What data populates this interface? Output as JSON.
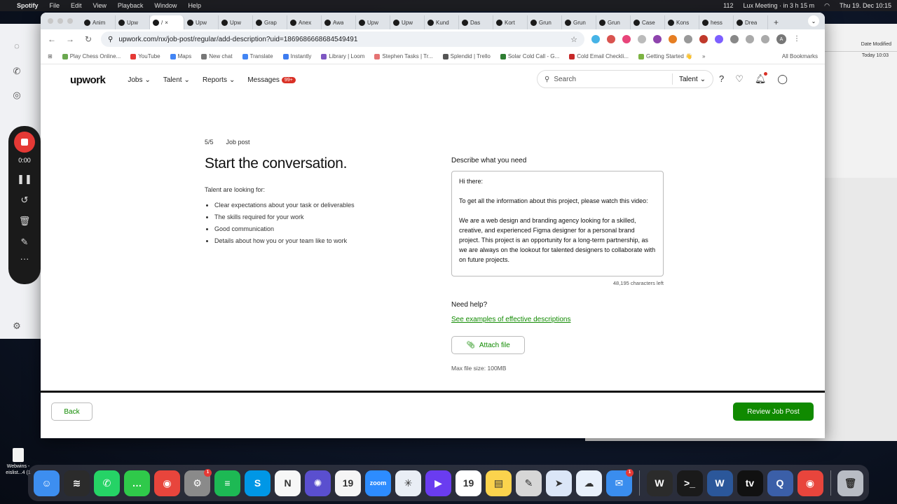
{
  "menubar": {
    "app_name": "Spotify",
    "menus": [
      "File",
      "Edit",
      "View",
      "Playback",
      "Window",
      "Help"
    ],
    "meeting": "Lux Meeting · in 3 h 15 m",
    "battery": "112",
    "datetime": "Thu 19. Dec 10:15"
  },
  "finder": {
    "col_header": "Date Modified",
    "row_value": "Today 10:03"
  },
  "recorder": {
    "time": "0:00"
  },
  "browser": {
    "tabs": [
      {
        "label": "Anim",
        "icon": "upwork-icon"
      },
      {
        "label": "Upw",
        "icon": "upwork-icon"
      },
      {
        "label": "/",
        "icon": "upwork-icon"
      },
      {
        "label": "Upw",
        "icon": "upwork-icon"
      },
      {
        "label": "Upw",
        "icon": "upwork-icon"
      },
      {
        "label": "Grap",
        "icon": "globe-icon"
      },
      {
        "label": "Anex",
        "icon": "youtube-icon"
      },
      {
        "label": "Awa",
        "icon": "youtube-icon"
      },
      {
        "label": "Upw",
        "icon": "upwork-icon"
      },
      {
        "label": "Upw",
        "icon": "upwork-icon"
      },
      {
        "label": "Kund",
        "icon": "doc-icon"
      },
      {
        "label": "Das",
        "icon": "k-icon"
      },
      {
        "label": "Kort",
        "icon": "doc-icon"
      },
      {
        "label": "Grun",
        "icon": "doc-icon"
      },
      {
        "label": "Grun",
        "icon": "dash-icon"
      },
      {
        "label": "Grun",
        "icon": "dash-icon"
      },
      {
        "label": "Case",
        "icon": "check-icon"
      },
      {
        "label": "Kons",
        "icon": "leaf-icon"
      },
      {
        "label": "hess",
        "icon": "google-icon"
      },
      {
        "label": "Drea",
        "icon": "note-icon"
      }
    ],
    "url": "upwork.com/nx/job-post/regular/add-description?uid=1869686668684549491",
    "bookmarks": [
      "Play Chess Online...",
      "YouTube",
      "Maps",
      "New chat",
      "Translate",
      "Instantly",
      "Library | Loom",
      "Stephen Tasks | Tr...",
      "Splendid | Trello",
      "Solar Cold Call - G...",
      "Cold Email Checkli...",
      "Getting Started 👋"
    ],
    "all_bookmarks": "All Bookmarks"
  },
  "upwork": {
    "logo": "upwork",
    "nav": {
      "jobs": "Jobs",
      "talent": "Talent",
      "reports": "Reports",
      "messages": "Messages",
      "messages_badge": "99+"
    },
    "search": {
      "placeholder": "Search",
      "scope": "Talent"
    },
    "step": {
      "count": "5/5",
      "label": "Job post"
    },
    "title": "Start the conversation.",
    "lead": "Talent are looking for:",
    "bullets": [
      "Clear expectations about your task or deliverables",
      "The skills required for your work",
      "Good communication",
      "Details about how you or your team like to work"
    ],
    "description": {
      "label": "Describe what you need",
      "text": "Hi there:\n\nTo get all the information about this project, please watch this video:\n\nWe are a web design and branding agency looking for a skilled, creative, and experienced Figma designer for a personal brand project. This project is an opportunity for a long-term partnership, as we are always on the lookout for talented designers to collaborate with on future projects.",
      "chars_left": "48,195 characters left"
    },
    "help": {
      "label": "Need help?",
      "link": "See examples of effective descriptions"
    },
    "attach_label": "Attach file",
    "max_size": "Max file size: 100MB",
    "footer": {
      "back": "Back",
      "review": "Review Job Post"
    }
  },
  "desktop_file": "Webwins - eislist...4 (1",
  "dock": [
    {
      "name": "finder-icon",
      "color": "#3d8ef0",
      "glyph": "☺"
    },
    {
      "name": "voice-memos-icon",
      "color": "#2b2b2b",
      "glyph": "≋"
    },
    {
      "name": "whatsapp-icon",
      "color": "#25d366",
      "glyph": "✆"
    },
    {
      "name": "messages-icon",
      "color": "#2fc94a",
      "glyph": "…"
    },
    {
      "name": "chrome-icon",
      "color": "#e8453c",
      "glyph": "◉"
    },
    {
      "name": "system-settings-icon",
      "color": "#8a8a8a",
      "glyph": "⚙",
      "badge": "1"
    },
    {
      "name": "spotify-icon",
      "color": "#1db954",
      "glyph": "≡"
    },
    {
      "name": "skype-icon",
      "color": "#0097e6",
      "glyph": "S"
    },
    {
      "name": "notion-icon",
      "color": "#f7f7f7",
      "glyph": "N"
    },
    {
      "name": "perplexity-icon",
      "color": "#5a4fcf",
      "glyph": "✺"
    },
    {
      "name": "calendar-19-icon",
      "color": "#f5f5f5",
      "glyph": "19"
    },
    {
      "name": "zoom-icon",
      "color": "#2d8cff",
      "glyph": "zoom"
    },
    {
      "name": "network-icon",
      "color": "#e9eef5",
      "glyph": "✳"
    },
    {
      "name": "infuse-icon",
      "color": "#6a3cf0",
      "glyph": "▶"
    },
    {
      "name": "calendar-icon",
      "color": "#ffffff",
      "glyph": "19"
    },
    {
      "name": "notes-icon",
      "color": "#fbd34d",
      "glyph": "▤"
    },
    {
      "name": "script-icon",
      "color": "#d6d6d6",
      "glyph": "✎"
    },
    {
      "name": "maps-arrow-icon",
      "color": "#dbe6f7",
      "glyph": "➤"
    },
    {
      "name": "cloud-icon",
      "color": "#e8f0fb",
      "glyph": "☁"
    },
    {
      "name": "mail-icon",
      "color": "#3a8dee",
      "glyph": "✉",
      "badge": "1"
    },
    {
      "name": "word-w-icon",
      "color": "#2b2b2b",
      "glyph": "W"
    },
    {
      "name": "terminal-icon",
      "color": "#1a1a1a",
      "glyph": ">_"
    },
    {
      "name": "ms-word-icon",
      "color": "#2b579a",
      "glyph": "W"
    },
    {
      "name": "apple-tv-icon",
      "color": "#111111",
      "glyph": "tv"
    },
    {
      "name": "quicktime-icon",
      "color": "#3b5fa8",
      "glyph": "Q"
    },
    {
      "name": "chrome-2-icon",
      "color": "#e8453c",
      "glyph": "◉"
    },
    {
      "name": "trash-icon",
      "color": "#b8bcc4",
      "glyph": "🗑"
    }
  ]
}
